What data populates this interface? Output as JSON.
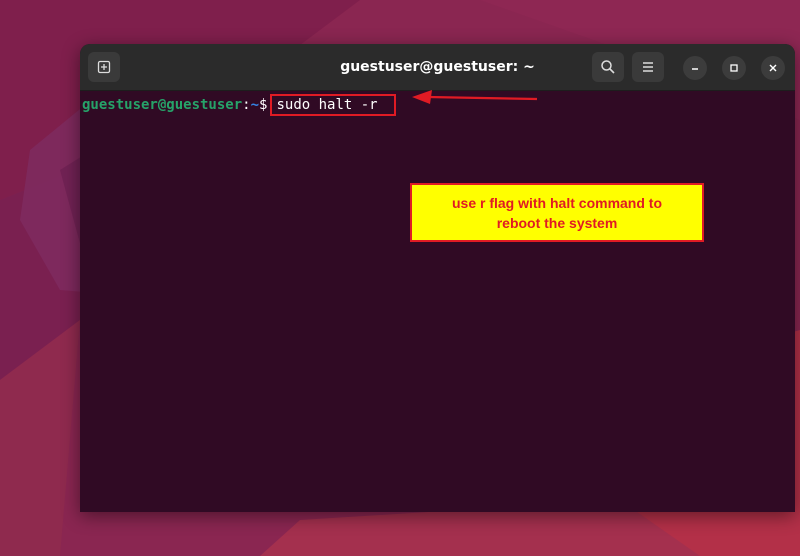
{
  "window": {
    "title": "guestuser@guestuser: ~"
  },
  "toolbar": {
    "new_tab_icon": "new-tab-icon",
    "search_icon": "search-icon",
    "menu_icon": "hamburger-menu-icon",
    "minimize_icon": "minimize-icon",
    "maximize_icon": "maximize-icon",
    "close_icon": "close-icon"
  },
  "terminal": {
    "prompt_user": "guestuser@guestuser",
    "prompt_colon": ":",
    "prompt_path": "~",
    "prompt_symbol": "$",
    "command": "sudo halt -r"
  },
  "annotation": {
    "text": "use r flag with halt command to reboot the system"
  },
  "colors": {
    "terminal_bg": "#300a24",
    "titlebar_bg": "#2b2b2b",
    "prompt_user": "#26a269",
    "prompt_path": "#3584e4",
    "highlight": "#e01b24",
    "annotation_bg": "#ffff00"
  }
}
